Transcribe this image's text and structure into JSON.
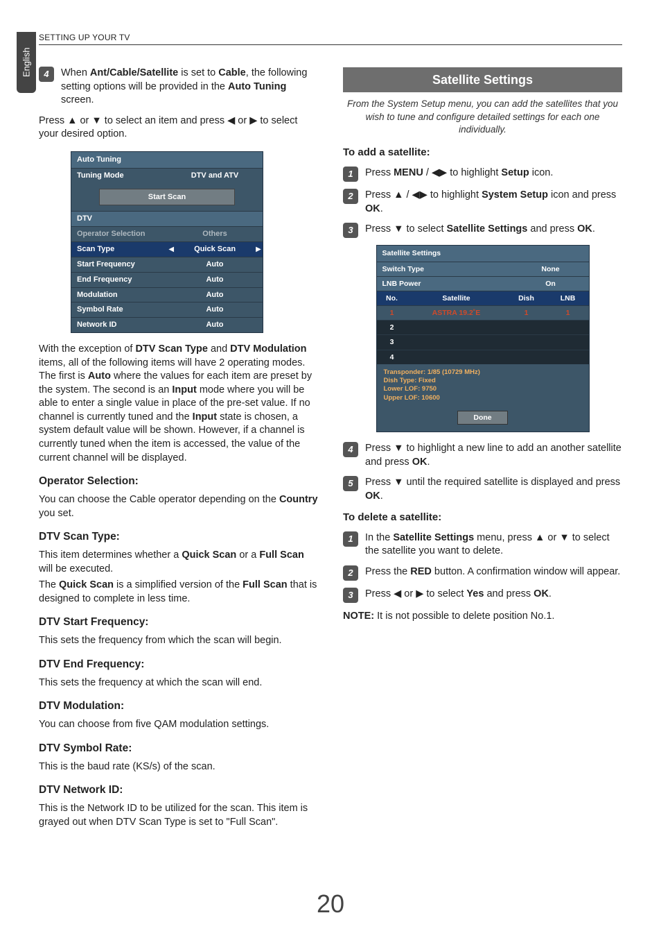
{
  "page": {
    "header": "SETTING UP YOUR TV",
    "language_tab": "English",
    "number": "20"
  },
  "left": {
    "step4_main": "When ",
    "step4_b1": "Ant/Cable/Satellite",
    "step4_mid1": " is set to ",
    "step4_b2": "Cable",
    "step4_mid2": ", the following setting options will be provided in the ",
    "step4_b3": "Auto Tuning",
    "step4_end": " screen.",
    "step4_press1": "Press ",
    "step4_press2": " or ",
    "step4_press3": " to select an item and press ",
    "step4_press4": " or ",
    "step4_press5": " to select your desired option.",
    "osd": {
      "title": "Auto Tuning",
      "rows": {
        "tuning_mode": {
          "label": "Tuning Mode",
          "value": "DTV and ATV"
        },
        "start_scan": "Start Scan",
        "dtv": "DTV",
        "operator": {
          "label": "Operator Selection",
          "value": "Others"
        },
        "scan_type": {
          "label": "Scan Type",
          "value": "Quick Scan"
        },
        "start_freq": {
          "label": "Start Frequency",
          "value": "Auto"
        },
        "end_freq": {
          "label": "End Frequency",
          "value": "Auto"
        },
        "modulation": {
          "label": "Modulation",
          "value": "Auto"
        },
        "symbol_rate": {
          "label": "Symbol Rate",
          "value": "Auto"
        },
        "network_id": {
          "label": "Network ID",
          "value": "Auto"
        }
      }
    },
    "body1_a": "With the exception of ",
    "body1_b1": "DTV Scan Type",
    "body1_b": " and ",
    "body1_b2": "DTV Modulation",
    "body1_c": " items, all of the following items will have 2 operating modes. The first is ",
    "body1_b3": "Auto",
    "body1_d": " where the values for each item are preset by the system. The second is an ",
    "body1_b4": "Input",
    "body1_e": " mode where you will be able to enter a single value in place of the pre-set value. If no channel is currently tuned and the ",
    "body1_b5": "Input",
    "body1_f": " state is chosen, a system default value will be shown. However, if a channel is currently tuned when the item is accessed, the value of the current channel will be displayed.",
    "h_operator": "Operator Selection:",
    "p_operator_a": "You can choose the Cable operator depending on the ",
    "p_operator_b": "Country",
    "p_operator_c": " you set.",
    "h_scantype": "DTV Scan Type:",
    "p_scantype_a": "This item determines whether a ",
    "p_scantype_b1": "Quick Scan",
    "p_scantype_b": " or a ",
    "p_scantype_b2": "Full Scan",
    "p_scantype_c": " will be executed.",
    "p_scantype2_a": "The ",
    "p_scantype2_b1": "Quick Scan",
    "p_scantype2_b": " is a simplified version of the ",
    "p_scantype2_b2": "Full Scan",
    "p_scantype2_c": " that is designed to complete in less time.",
    "h_startfreq": "DTV Start Frequency:",
    "p_startfreq": "This sets the frequency from which the scan will begin.",
    "h_endfreq": "DTV End Frequency:",
    "p_endfreq": "This sets the frequency at which the scan will end.",
    "h_mod": "DTV Modulation:",
    "p_mod": "You can choose from five QAM modulation settings.",
    "h_symrate": "DTV Symbol Rate:",
    "p_symrate": "This is the baud rate (KS/s) of the scan.",
    "h_netid": "DTV Network ID:",
    "p_netid": "This is the Network ID to be utilized for the scan. This item is grayed out when DTV Scan Type is set to \"Full Scan\"."
  },
  "right": {
    "title": "Satellite Settings",
    "intro": "From the System Setup menu, you can add the satellites that you wish to tune and configure detailed settings for each one individually.",
    "add_h": "To add a satellite:",
    "add_s1_a": "Press ",
    "add_s1_b1": "MENU",
    "add_s1_b": " / ",
    "add_s1_c": " to highlight ",
    "add_s1_b2": "Setup",
    "add_s1_d": " icon.",
    "add_s2_a": "Press ",
    "add_s2_b": " / ",
    "add_s2_c": " to highlight ",
    "add_s2_b1": "System Setup",
    "add_s2_d": " icon and press ",
    "add_s2_b2": "OK",
    "add_s2_e": ".",
    "add_s3_a": "Press ",
    "add_s3_b": " to select ",
    "add_s3_b1": "Satellite Settings",
    "add_s3_c": " and press ",
    "add_s3_b2": "OK",
    "add_s3_d": ".",
    "sat_osd": {
      "title": "Satellite Settings",
      "switch_type": {
        "label": "Switch Type",
        "value": "None"
      },
      "lnb_power": {
        "label": "LNB Power",
        "value": "On"
      },
      "head": {
        "no": "No.",
        "satellite": "Satellite",
        "dish": "Dish",
        "lnb": "LNB"
      },
      "rows": [
        {
          "no": "1",
          "satellite": "ASTRA 19.2˚E",
          "dish": "1",
          "lnb": "1"
        },
        {
          "no": "2",
          "satellite": "",
          "dish": "",
          "lnb": ""
        },
        {
          "no": "3",
          "satellite": "",
          "dish": "",
          "lnb": ""
        },
        {
          "no": "4",
          "satellite": "",
          "dish": "",
          "lnb": ""
        }
      ],
      "info1": "Transponder: 1/85 (10729 MHz)",
      "info2": "Dish Type: Fixed",
      "info3": "Lower LOF: 9750",
      "info4": "Upper LOF: 10600",
      "done": "Done"
    },
    "add_s4_a": "Press ",
    "add_s4_b": " to highlight a new line to add an another satellite and press ",
    "add_s4_b1": "OK",
    "add_s4_c": ".",
    "add_s5_a": "Press ",
    "add_s5_b": " until the required satellite is displayed and press ",
    "add_s5_b1": "OK",
    "add_s5_c": ".",
    "del_h": "To delete a satellite:",
    "del_s1_a": "In the ",
    "del_s1_b1": "Satellite Settings",
    "del_s1_b": " menu, press ",
    "del_s1_c": " or ",
    "del_s1_d": " to select the satellite you want to delete.",
    "del_s2_a": "Press the ",
    "del_s2_b1": "RED",
    "del_s2_b": " button. A confirmation window will appear.",
    "del_s3_a": "Press ",
    "del_s3_b": " or ",
    "del_s3_c": " to select ",
    "del_s3_b1": "Yes",
    "del_s3_d": " and press ",
    "del_s3_b2": "OK",
    "del_s3_e": ".",
    "note_a": "NOTE:",
    "note_b": " It is not possible to delete position No.1."
  },
  "arrows": {
    "up": "▲",
    "down": "▼",
    "left": "◀",
    "right": "▶",
    "leftright": "◀▶"
  }
}
